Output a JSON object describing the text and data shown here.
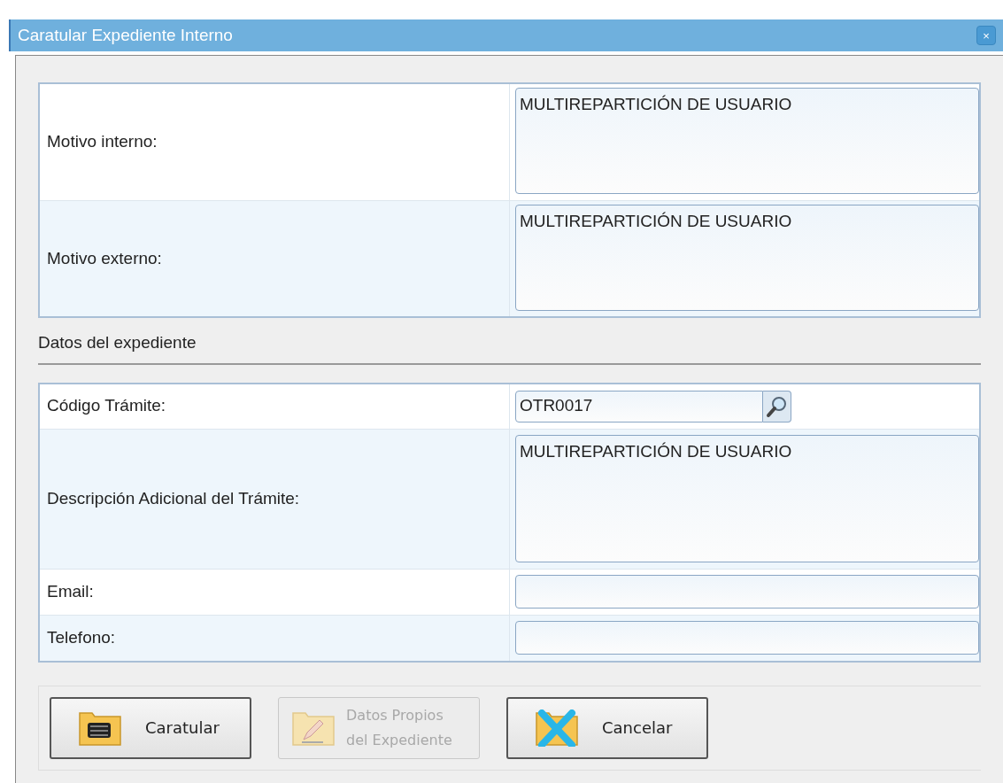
{
  "window": {
    "title": "Caratular Expediente Interno",
    "close_label": "×"
  },
  "motivos": [
    {
      "label": "Motivo interno:",
      "value": "MULTIREPARTICIÓN DE USUARIO"
    },
    {
      "label": "Motivo externo:",
      "value": "MULTIREPARTICIÓN DE USUARIO"
    }
  ],
  "section_title": "Datos del expediente",
  "fields": [
    {
      "kind": "search",
      "label": "Código Trámite:",
      "value": "OTR0017"
    },
    {
      "kind": "textarea",
      "label": "Descripción Adicional del Trámite:",
      "value": "MULTIREPARTICIÓN DE USUARIO"
    },
    {
      "kind": "text",
      "label": "Email:"
    },
    {
      "kind": "text",
      "label": "Telefono:"
    }
  ],
  "buttons": [
    {
      "kind": "counter",
      "lines": [
        "Caratular"
      ],
      "disabled": false
    },
    {
      "kind": "pencil",
      "lines": [
        "Datos Propios",
        "del Expediente"
      ],
      "disabled": true
    },
    {
      "kind": "cancel",
      "lines": [
        "Cancelar"
      ],
      "disabled": false
    }
  ]
}
